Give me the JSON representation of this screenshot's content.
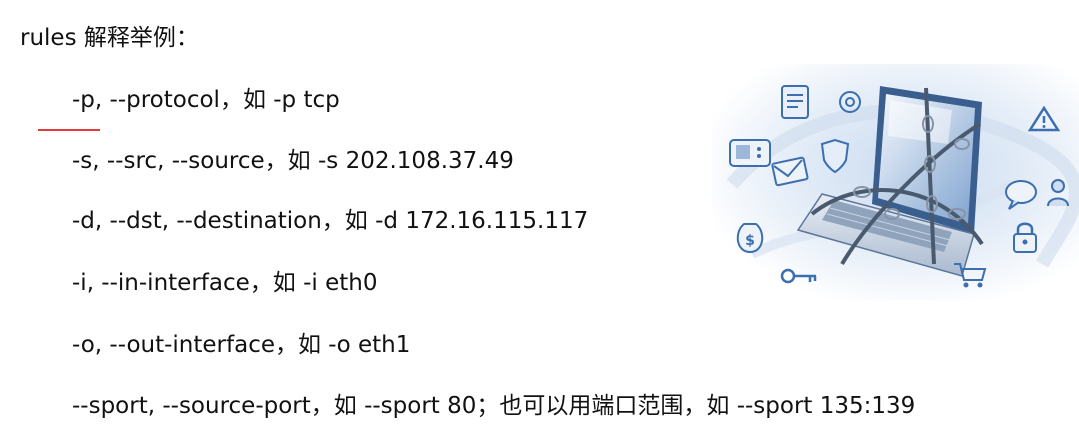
{
  "slide": {
    "title": "rules 解释举例：",
    "rules": [
      "-p, --protocol，如 -p tcp",
      "-s, --src, --source，如 -s 202.108.37.49",
      "-d, --dst, --destination，如 -d 172.16.115.117",
      "-i, --in-interface，如 -i eth0",
      "-o, --out-interface，如 -o eth1",
      "--sport, --source-port，如 --sport 80；也可以用端口范围，如 --sport 135:139"
    ]
  },
  "colors": {
    "text": "#111111",
    "accent_mark": "#e23b3b",
    "illustration_blue": "#3b6fb0",
    "illustration_light": "#dde8f5"
  },
  "illustration": {
    "subject": "laptop-wrapped-in-chains-with-security-icons",
    "icons": [
      "document-icon",
      "at-sign-icon",
      "warning-icon",
      "shield-icon",
      "monitor-icon",
      "email-icon",
      "chat-icon",
      "money-bag-icon",
      "padlock-icon",
      "key-icon",
      "shopping-cart-icon"
    ]
  }
}
